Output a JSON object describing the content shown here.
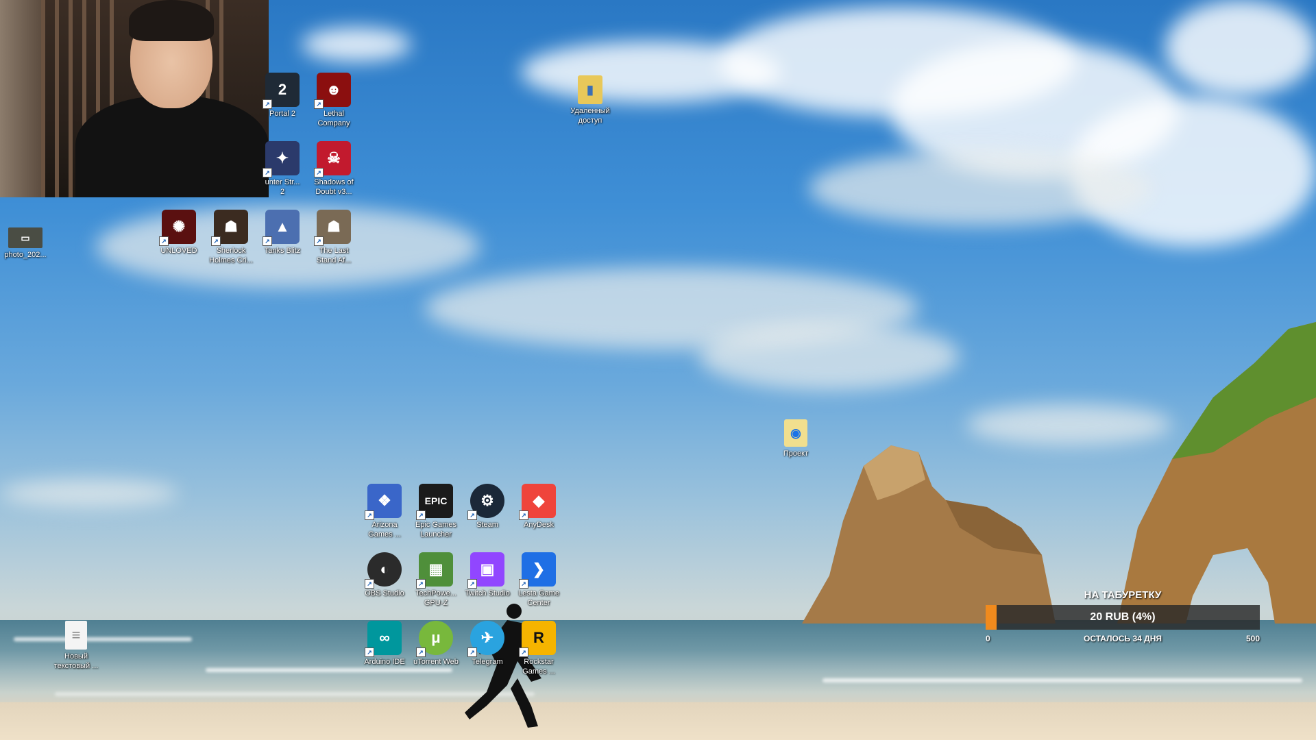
{
  "desktop_icons": {
    "portal2": {
      "label": "Portal 2",
      "glyph": "2",
      "icon": "portal2-icon",
      "color": "#1f2a36"
    },
    "lethal": {
      "label": "Lethal\nCompany",
      "glyph": "☻",
      "icon": "lethal-company-icon",
      "color": "#8b0f0f"
    },
    "counterstrike": {
      "label": "unter Str...\n2",
      "glyph": "✦",
      "icon": "counter-strike-icon",
      "color": "#2b3a6b"
    },
    "shadows": {
      "label": "Shadows of\nDoubt v3...",
      "glyph": "☠",
      "icon": "shadows-of-doubt-icon",
      "color": "#c21a2e"
    },
    "photo": {
      "label": "photo_202...",
      "glyph": "▭",
      "icon": "photo-icon",
      "color": "#4a4d44"
    },
    "unloved": {
      "label": "UNLOVED",
      "glyph": "✺",
      "icon": "unloved-icon",
      "color": "#5a1010"
    },
    "sherlock": {
      "label": "Sherlock\nHolmes Cri...",
      "glyph": "☗",
      "icon": "sherlock-holmes-icon",
      "color": "#3b2b20"
    },
    "tanks": {
      "label": "Tanks Blitz",
      "glyph": "▲",
      "icon": "tanks-blitz-icon",
      "color": "#4c6fb0"
    },
    "laststand": {
      "label": "The Last\nStand Af...",
      "glyph": "☗",
      "icon": "the-last-stand-icon",
      "color": "#7a6a55"
    },
    "remote": {
      "label": "Удаленный\nдоступ",
      "glyph": "▮",
      "icon": "remote-access-folder-icon",
      "color": "#e8c85a"
    },
    "project": {
      "label": "Проект",
      "glyph": "◉",
      "icon": "project-folder-icon",
      "color": "#f1df8e"
    },
    "arizona": {
      "label": "Arizona\nGames ...",
      "glyph": "❖",
      "icon": "arizona-games-icon",
      "color": "#3a66c9"
    },
    "epic": {
      "label": "Epic Games\nLauncher",
      "glyph": "EPIC",
      "icon": "epic-games-icon",
      "color": "#1b1b1b"
    },
    "steam": {
      "label": "Steam",
      "glyph": "⚙",
      "icon": "steam-icon",
      "color": "#1b2838"
    },
    "anydesk": {
      "label": "AnyDesk",
      "glyph": "◆",
      "icon": "anydesk-icon",
      "color": "#ef443b"
    },
    "obs": {
      "label": "OBS Studio",
      "glyph": "◐",
      "icon": "obs-studio-icon",
      "color": "#2b2b2b"
    },
    "gpuz": {
      "label": "TechPowe...\nGPU-Z",
      "glyph": "▦",
      "icon": "gpu-z-icon",
      "color": "#4f8f3a"
    },
    "twitch": {
      "label": "Twitch Studio",
      "glyph": "▣",
      "icon": "twitch-studio-icon",
      "color": "#9146ff"
    },
    "lesta": {
      "label": "Lesta Game\nCenter",
      "glyph": "❯",
      "icon": "lesta-game-center-icon",
      "color": "#1f6fe5"
    },
    "newtext": {
      "label": "Новый\nтекстовый ...",
      "glyph": "≡",
      "icon": "text-document-icon",
      "color": "#f4f4f4"
    },
    "arduino": {
      "label": "Arduino IDE",
      "glyph": "∞",
      "icon": "arduino-ide-icon",
      "color": "#00979d"
    },
    "utorrent": {
      "label": "uTorrent Web",
      "glyph": "μ",
      "icon": "utorrent-icon",
      "color": "#78b83c"
    },
    "telegram": {
      "label": "Telegram",
      "glyph": "✈",
      "icon": "telegram-icon",
      "color": "#2aa3df"
    },
    "rockstar": {
      "label": "Rockstar\nGames ...",
      "glyph": "R",
      "icon": "rockstar-games-icon",
      "color": "#f5b400"
    }
  },
  "donation_widget": {
    "title": "НА ТАБУРЕТКУ",
    "amount": "20 RUB (4%)",
    "min": "0",
    "max": "500",
    "remaining": "ОСТАЛОСЬ 34 ДНЯ",
    "progress_fraction": 0.04,
    "accent_color": "#f08a1d"
  }
}
